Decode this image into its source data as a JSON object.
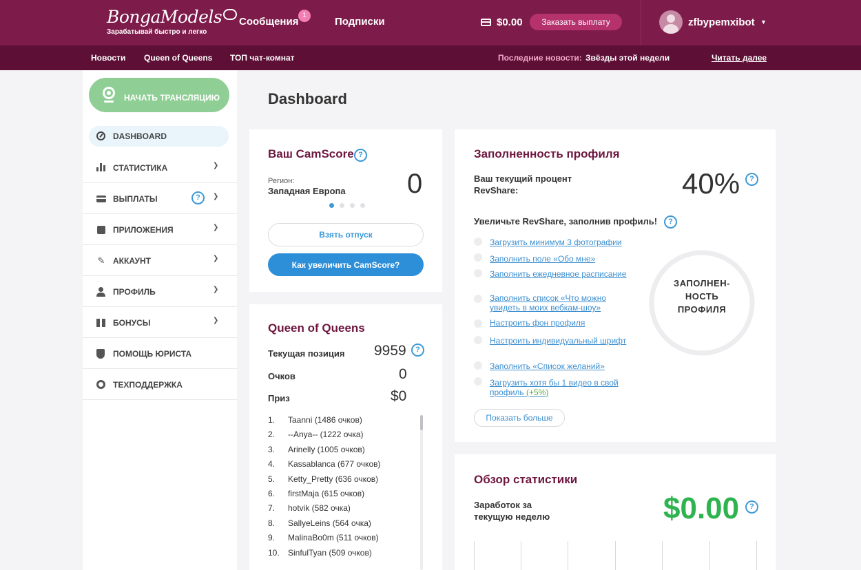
{
  "header": {
    "logo_text": "BongaModels",
    "logo_tagline": "Зарабатывай быстро и легко",
    "nav": [
      {
        "label": "Сообщения",
        "badge": "1"
      },
      {
        "label": "Подписки"
      }
    ],
    "balance": "$0.00",
    "payout_button": "Заказать выплату",
    "username": "zfbypemxibot",
    "icons": {
      "wallet": "wallet-icon",
      "caret": "chevron-down-icon"
    }
  },
  "subbar": {
    "links": [
      "Новости",
      "Queen of Queens",
      "ТОП чат-комнат"
    ],
    "news_label": "Последние новости:",
    "news_value": "Звёзды этой недели",
    "read_more": "Читать далее"
  },
  "sidebar": {
    "start_button": "НАЧАТЬ ТРАНСЛЯЦИЮ",
    "items": [
      {
        "label": "DASHBOARD",
        "icon": "gauge-icon",
        "active": true
      },
      {
        "label": "СТАТИСТИКА",
        "icon": "bar-chart-icon"
      },
      {
        "label": "ВЫПЛАТЫ",
        "icon": "credit-card-icon",
        "help": "?"
      },
      {
        "label": "ПРИЛОЖЕНИЯ",
        "icon": "puzzle-icon"
      },
      {
        "label": "АККАУНТ",
        "icon": "wrench-icon"
      },
      {
        "label": "ПРОФИЛЬ",
        "icon": "user-icon"
      },
      {
        "label": "БОНУСЫ",
        "icon": "gift-icon"
      },
      {
        "label": "ПОМОЩЬ ЮРИСТА",
        "icon": "shield-icon"
      },
      {
        "label": "ТЕХПОДДЕРЖКА",
        "icon": "headset-icon"
      }
    ]
  },
  "main": {
    "title": "Dashboard",
    "camscore": {
      "title": "Ваш CamScore",
      "region_label": "Регион:",
      "region_value": "Западная Европа",
      "score": "0",
      "vacation_button": "Взять отпуск",
      "improve_button": "Как увеличить CamScore?"
    },
    "queen": {
      "title": "Queen of Queens",
      "position_label": "Текущая позиция",
      "position_value": "9959",
      "points_label": "Очков",
      "points_value": "0",
      "prize_label": "Приз",
      "prize_value": "$0",
      "leaders": [
        {
          "rank": "1.",
          "name": "Taanni (1486 очков)"
        },
        {
          "rank": "2.",
          "name": "--Anya-- (1222 очка)"
        },
        {
          "rank": "3.",
          "name": "Arinelly (1005 очков)"
        },
        {
          "rank": "4.",
          "name": "Kassablanca (677 очков)"
        },
        {
          "rank": "5.",
          "name": "Ketty_Pretty (636 очков)"
        },
        {
          "rank": "6.",
          "name": "firstMaja (615 очков)"
        },
        {
          "rank": "7.",
          "name": "hotvik (582 очка)"
        },
        {
          "rank": "8.",
          "name": "SallyeLeins (564 очка)"
        },
        {
          "rank": "9.",
          "name": "MalinaBo0m (511 очков)"
        },
        {
          "rank": "10.",
          "name": "SinfulTyan (509 очков)"
        }
      ]
    },
    "profile": {
      "title": "Заполненность профиля",
      "revshare_label": "Ваш текущий процент RevShare:",
      "revshare_value": "40%",
      "increase_label": "Увеличьте RevShare, заполнив профиль!",
      "tasks": [
        {
          "label": "Загрузить минимум 3 фотографии"
        },
        {
          "label": "Заполнить поле «Обо мне»"
        },
        {
          "label": "Заполнить ежедневное расписание"
        },
        {
          "label": "Заполнить список «Что можно увидеть в моих вебкам-шоу»"
        },
        {
          "label": "Настроить фон профиля"
        },
        {
          "label": "Настроить индивидуальный шрифт"
        },
        {
          "label": "Заполнить «Список желаний»"
        },
        {
          "label": "Загрузить хотя бы 1 видео в свой профиль",
          "extra": "(+5%)"
        }
      ],
      "show_more": "Показать больше",
      "ring_label": "ЗАПОЛНЕН-НОСТЬ ПРОФИЛЯ"
    },
    "stats": {
      "title": "Обзор статистики",
      "earnings_label": "Заработок за текущую неделю",
      "earnings_value": "$0.00"
    }
  },
  "colors": {
    "header_bg": "#7d1b4a",
    "subbar_bg": "#5e0f36",
    "accent_blue": "#2e8fd9",
    "start_green": "#8fcf95",
    "earnings_green": "#2eb34f",
    "title_maroon": "#6e1740"
  }
}
